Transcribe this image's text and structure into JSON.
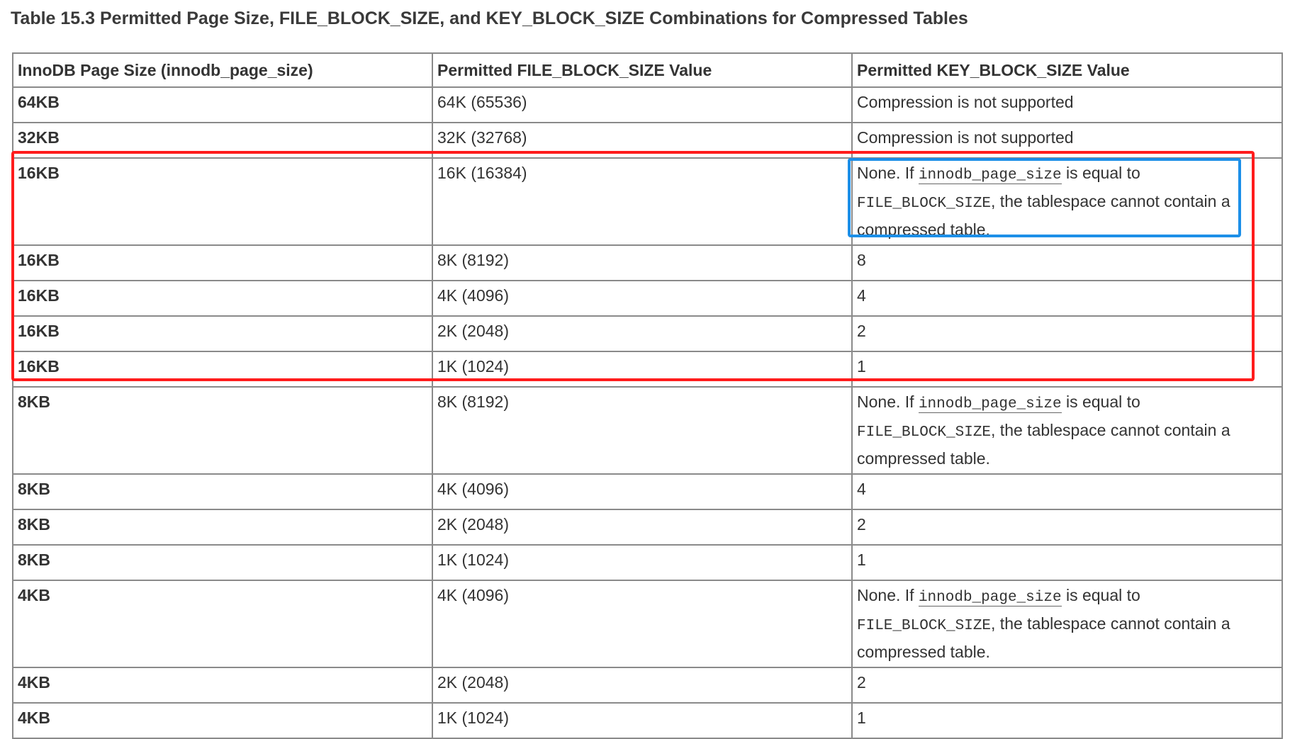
{
  "caption": "Table 15.3 Permitted Page Size, FILE_BLOCK_SIZE, and KEY_BLOCK_SIZE Combinations for Compressed Tables",
  "columns": [
    "InnoDB Page Size (innodb_page_size)",
    "Permitted FILE_BLOCK_SIZE Value",
    "Permitted KEY_BLOCK_SIZE Value"
  ],
  "rows": [
    {
      "page_size": "64KB",
      "file_block_size": "64K (65536)",
      "key_block_size": "Compression is not supported"
    },
    {
      "page_size": "32KB",
      "file_block_size": "32K (32768)",
      "key_block_size": "Compression is not supported"
    },
    {
      "page_size": "16KB",
      "file_block_size": "16K (16384)",
      "key_block_size": null
    },
    {
      "page_size": "16KB",
      "file_block_size": "8K (8192)",
      "key_block_size": "8"
    },
    {
      "page_size": "16KB",
      "file_block_size": "4K (4096)",
      "key_block_size": "4"
    },
    {
      "page_size": "16KB",
      "file_block_size": "2K (2048)",
      "key_block_size": "2"
    },
    {
      "page_size": "16KB",
      "file_block_size": "1K (1024)",
      "key_block_size": "1"
    },
    {
      "page_size": "8KB",
      "file_block_size": "8K (8192)",
      "key_block_size": null
    },
    {
      "page_size": "8KB",
      "file_block_size": "4K (4096)",
      "key_block_size": "4"
    },
    {
      "page_size": "8KB",
      "file_block_size": "2K (2048)",
      "key_block_size": "2"
    },
    {
      "page_size": "8KB",
      "file_block_size": "1K (1024)",
      "key_block_size": "1"
    },
    {
      "page_size": "4KB",
      "file_block_size": "4K (4096)",
      "key_block_size": null
    },
    {
      "page_size": "4KB",
      "file_block_size": "2K (2048)",
      "key_block_size": "2"
    },
    {
      "page_size": "4KB",
      "file_block_size": "1K (1024)",
      "key_block_size": "1"
    }
  ],
  "none_note": {
    "prefix": "None. If ",
    "code1": "innodb_page_size",
    "middle": " is equal to ",
    "code2": "FILE_BLOCK_SIZE",
    "suffix": ", the tablespace cannot contain a compressed table."
  },
  "annotations": {
    "red_box_color": "#ff1c1c",
    "blue_box_color": "#1c8fe8"
  }
}
